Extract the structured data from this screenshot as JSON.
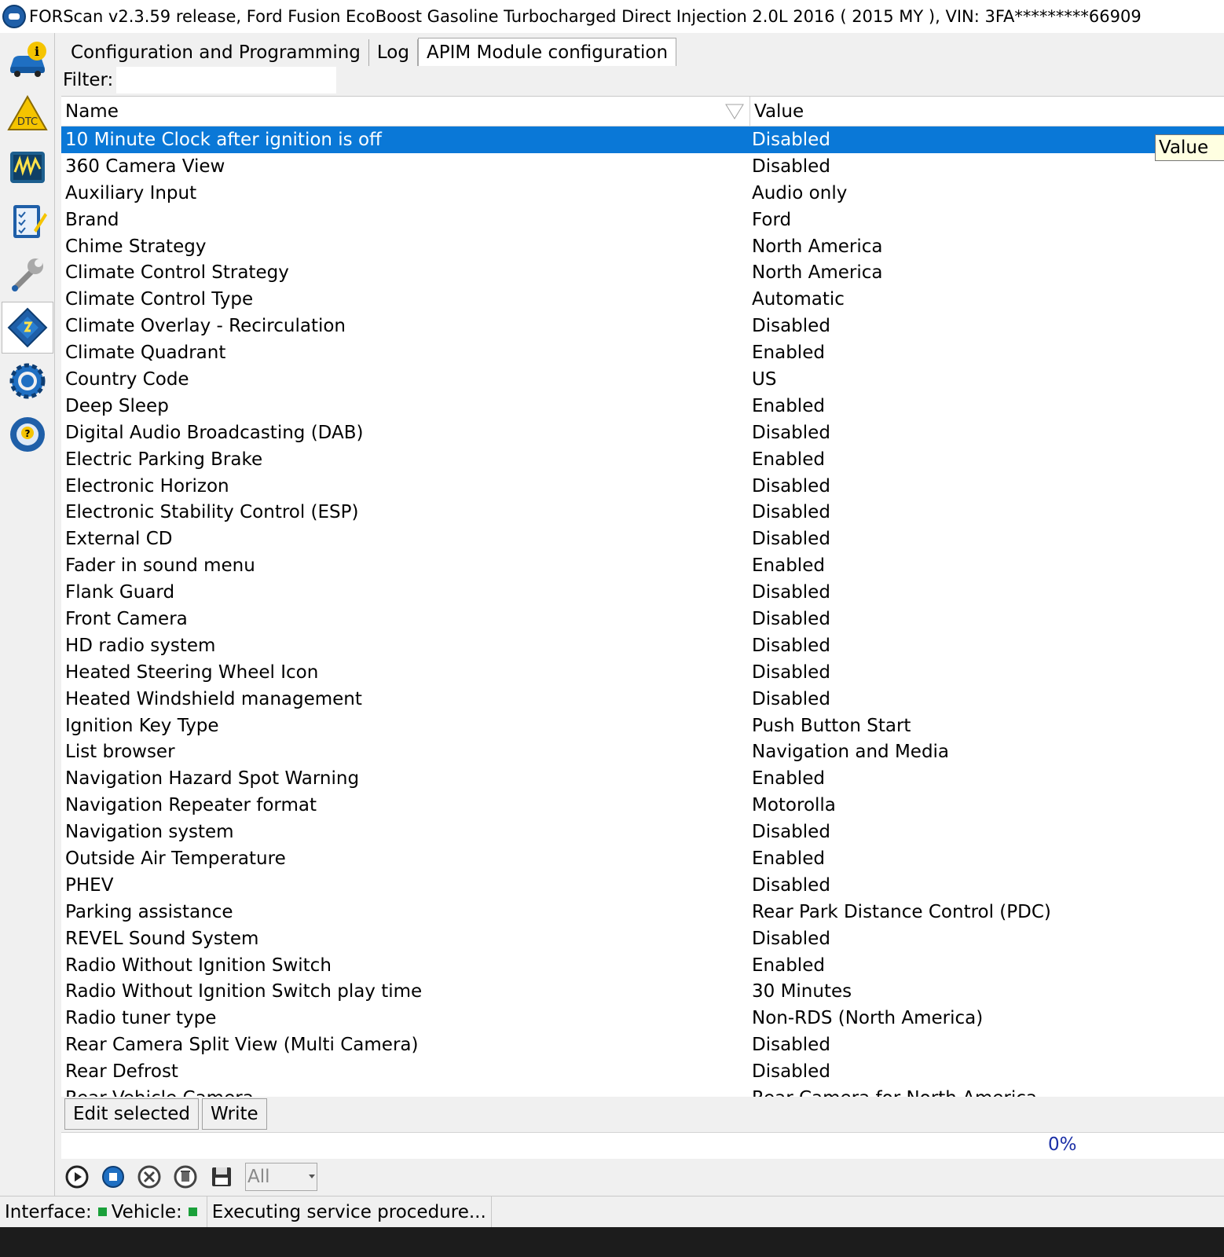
{
  "window": {
    "title": "FORScan v2.3.59 release, Ford Fusion EcoBoost Gasoline Turbocharged Direct Injection 2.0L 2016 ( 2015 MY ), VIN: 3FA*********66909"
  },
  "sidebar": {
    "items": [
      {
        "icon": "vehicle-info-icon"
      },
      {
        "icon": "dtc-icon",
        "label": "DTC"
      },
      {
        "icon": "oscilloscope-icon"
      },
      {
        "icon": "checklist-icon"
      },
      {
        "icon": "wrench-icon"
      },
      {
        "icon": "chip-config-icon",
        "active": true
      },
      {
        "icon": "settings-gear-icon"
      },
      {
        "icon": "help-icon",
        "label": "?"
      }
    ]
  },
  "tabs": [
    {
      "label": "Configuration and Programming"
    },
    {
      "label": "Log"
    },
    {
      "label": "APIM Module configuration",
      "active": true
    }
  ],
  "filter": {
    "label": "Filter:",
    "value": ""
  },
  "table": {
    "headers": {
      "name": "Name",
      "value": "Value"
    },
    "tooltip": "Value",
    "rows": [
      {
        "name": "10 Minute Clock after ignition is off",
        "value": "Disabled",
        "selected": true
      },
      {
        "name": "360 Camera View",
        "value": "Disabled"
      },
      {
        "name": "Auxiliary Input",
        "value": "Audio only"
      },
      {
        "name": "Brand",
        "value": "Ford"
      },
      {
        "name": "Chime Strategy",
        "value": "North America"
      },
      {
        "name": "Climate Control Strategy",
        "value": "North America"
      },
      {
        "name": "Climate Control Type",
        "value": "Automatic"
      },
      {
        "name": "Climate Overlay - Recirculation",
        "value": "Disabled"
      },
      {
        "name": "Climate Quadrant",
        "value": "Enabled"
      },
      {
        "name": "Country Code",
        "value": "US"
      },
      {
        "name": "Deep Sleep",
        "value": "Enabled"
      },
      {
        "name": "Digital Audio Broadcasting (DAB)",
        "value": "Disabled"
      },
      {
        "name": "Electric Parking Brake",
        "value": "Enabled"
      },
      {
        "name": "Electronic Horizon",
        "value": "Disabled"
      },
      {
        "name": "Electronic Stability Control (ESP)",
        "value": "Disabled"
      },
      {
        "name": "External CD",
        "value": "Disabled"
      },
      {
        "name": "Fader in sound menu",
        "value": "Enabled"
      },
      {
        "name": "Flank Guard",
        "value": "Disabled"
      },
      {
        "name": "Front Camera",
        "value": "Disabled"
      },
      {
        "name": "HD radio system",
        "value": "Disabled"
      },
      {
        "name": "Heated Steering Wheel Icon",
        "value": "Disabled"
      },
      {
        "name": "Heated Windshield management",
        "value": "Disabled"
      },
      {
        "name": "Ignition Key Type",
        "value": "Push Button Start"
      },
      {
        "name": "List browser",
        "value": "Navigation and Media"
      },
      {
        "name": "Navigation Hazard Spot Warning",
        "value": "Enabled"
      },
      {
        "name": "Navigation Repeater format",
        "value": "Motorolla"
      },
      {
        "name": "Navigation system",
        "value": "Disabled"
      },
      {
        "name": "Outside Air Temperature",
        "value": "Enabled"
      },
      {
        "name": "PHEV",
        "value": "Disabled"
      },
      {
        "name": "Parking assistance",
        "value": "Rear Park Distance Control (PDC)"
      },
      {
        "name": "REVEL Sound System",
        "value": "Disabled"
      },
      {
        "name": "Radio Without Ignition Switch",
        "value": "Enabled"
      },
      {
        "name": "Radio Without Ignition Switch play time",
        "value": "30 Minutes"
      },
      {
        "name": "Radio tuner type",
        "value": "Non-RDS (North America)"
      },
      {
        "name": "Rear Camera Split View (Multi Camera)",
        "value": "Disabled"
      },
      {
        "name": "Rear Defrost",
        "value": "Disabled"
      },
      {
        "name": "Rear Vehicle Camera",
        "value": "Rear Camera for North America"
      }
    ]
  },
  "buttons": {
    "edit_selected": "Edit selected",
    "write": "Write"
  },
  "progress": {
    "percent_label": "0%",
    "percent": 0
  },
  "toolbar": {
    "icons": [
      "play-icon",
      "stop-icon",
      "clear-icon",
      "delete-icon",
      "save-icon"
    ],
    "select_value": "All"
  },
  "status": {
    "interface_label": "Interface:",
    "vehicle_label": "Vehicle:",
    "message": "Executing service procedure...",
    "indicator_color": "#1aa03a"
  },
  "colors": {
    "selection": "#0a78d7",
    "progress_text": "#1b2fa6"
  }
}
